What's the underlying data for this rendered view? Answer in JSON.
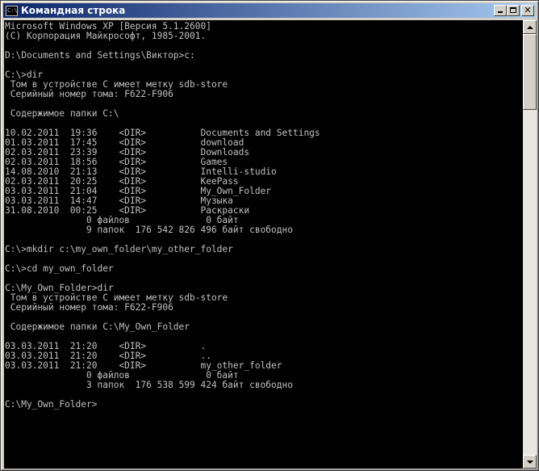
{
  "window": {
    "title": "Командная строка",
    "icon": "cmd-icon",
    "icon_text": "C:\\",
    "buttons": {
      "minimize": "minimize-icon",
      "maximize": "maximize-icon",
      "close": "close-icon",
      "close_glyph": "✕"
    }
  },
  "colors": {
    "titlebar_start": "#0a246a",
    "titlebar_end": "#a6caf0",
    "console_bg": "#000000",
    "console_text": "#c0c0c0",
    "chrome": "#d4d0c8"
  },
  "scrollbar": {
    "position_fraction": 0.0,
    "visible_fraction": 0.18
  },
  "console": {
    "lines": [
      "Microsoft Windows XP [Версия 5.1.2600]",
      "(С) Корпорация Майкрософт, 1985-2001.",
      "",
      "D:\\Documents and Settings\\Виктор>c:",
      "",
      "C:\\>dir",
      " Том в устройстве C имеет метку sdb-store",
      " Серийный номер тома: F622-F906",
      "",
      " Содержимое папки C:\\",
      "",
      "10.02.2011  19:36    <DIR>          Documents and Settings",
      "01.03.2011  17:45    <DIR>          download",
      "02.03.2011  23:39    <DIR>          Downloads",
      "02.03.2011  18:56    <DIR>          Games",
      "14.08.2010  21:13    <DIR>          Intelli-studio",
      "02.03.2011  20:25    <DIR>          KeePass",
      "03.03.2011  21:04    <DIR>          My_Own_Folder",
      "03.03.2011  14:47    <DIR>          Музыка",
      "31.08.2010  00:25    <DIR>          Раскраски",
      "               0 файлов              0 байт",
      "               9 папок  176 542 826 496 байт свободно",
      "",
      "C:\\>mkdir c:\\my_own_folder\\my_other_folder",
      "",
      "C:\\>cd my_own_folder",
      "",
      "C:\\My_Own_Folder>dir",
      " Том в устройстве C имеет метку sdb-store",
      " Серийный номер тома: F622-F906",
      "",
      " Содержимое папки C:\\My_Own_Folder",
      "",
      "03.03.2011  21:20    <DIR>          .",
      "03.03.2011  21:20    <DIR>          ..",
      "03.03.2011  21:20    <DIR>          my_other_folder",
      "               0 файлов              0 байт",
      "               3 папок  176 538 599 424 байт свободно",
      "",
      "C:\\My_Own_Folder>"
    ]
  }
}
